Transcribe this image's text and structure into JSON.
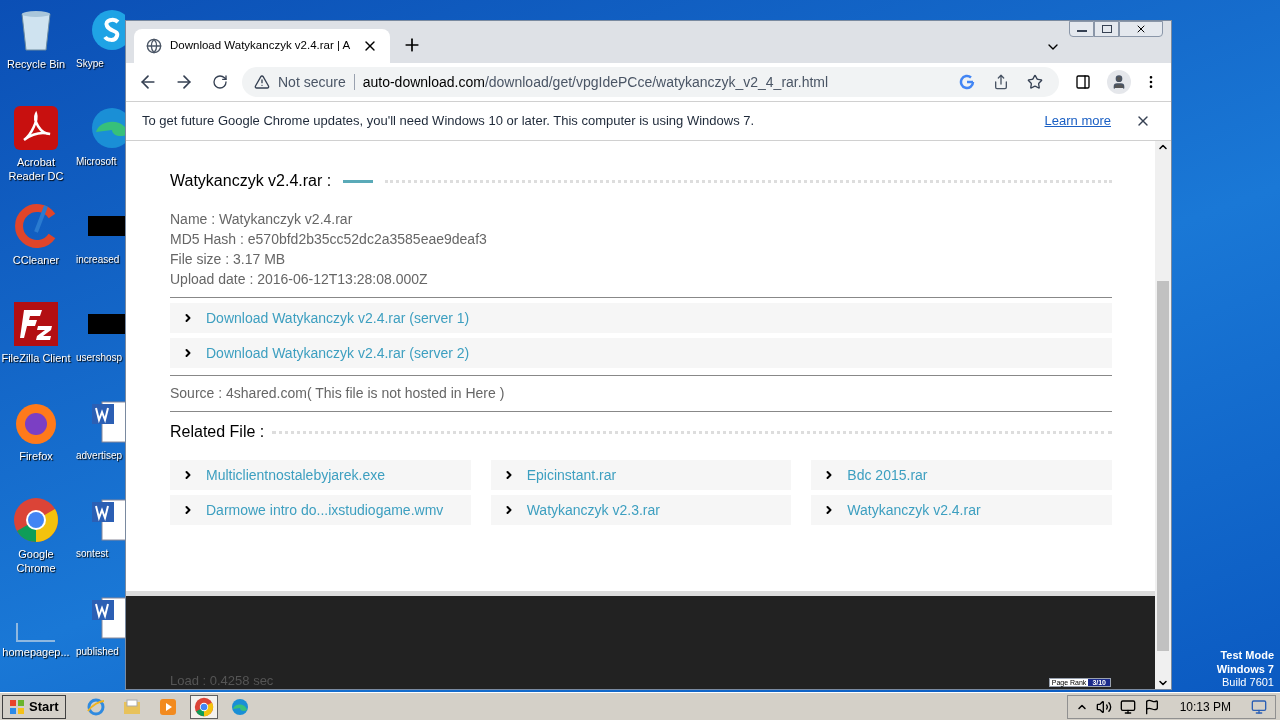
{
  "desktop": {
    "icons": [
      {
        "label": "Recycle Bin",
        "kind": "recycle"
      },
      {
        "label": "Skype",
        "kind": "skype"
      },
      {
        "label": "Acrobat Reader DC",
        "kind": "pdf"
      },
      {
        "label": "Microsoft",
        "kind": "edge"
      },
      {
        "label": "CCleaner",
        "kind": "ccleaner"
      },
      {
        "label": "increased",
        "kind": "black"
      },
      {
        "label": "FileZilla Client",
        "kind": "filezilla"
      },
      {
        "label": "usershosp",
        "kind": "black"
      },
      {
        "label": "Firefox",
        "kind": "firefox"
      },
      {
        "label": "advertisep",
        "kind": "word"
      },
      {
        "label": "Google Chrome",
        "kind": "chrome"
      },
      {
        "label": "sontest",
        "kind": "word"
      },
      {
        "label": "homepagep...",
        "kind": "blank"
      },
      {
        "label": "published",
        "kind": "word"
      }
    ],
    "watermark": [
      "Test Mode",
      "Windows 7",
      "Build 7601"
    ]
  },
  "browser": {
    "tab": {
      "title": "Download Watykanczyk v2.4.rar | A",
      "selected": true
    },
    "address": {
      "security": "Not secure",
      "host": "auto-download.com",
      "path": "/download/get/vpgIdePCce/watykanczyk_v2_4_rar.html"
    },
    "infobar": {
      "message": "To get future Google Chrome updates, you'll need Windows 10 or later. This computer is using Windows 7.",
      "link": "Learn more"
    }
  },
  "page": {
    "heading": "Watykanczyk v2.4.rar :",
    "details": [
      "Name : Watykanczyk v2.4.rar",
      "MD5 Hash : e570bfd2b35cc52dc2a3585eae9deaf3",
      "File size : 3.17 MB",
      "Upload date : 2016-06-12T13:28:08.000Z"
    ],
    "downloads": [
      "Download Watykanczyk v2.4.rar (server 1)",
      "Download Watykanczyk v2.4.rar (server 2)"
    ],
    "source": "Source : 4shared.com( This file is not hosted in Here )",
    "related_heading": "Related File :",
    "related": [
      "Multiclientnostalebyjarek.exe",
      "Epicinstant.rar",
      "Bdc 2015.rar",
      "Darmowe intro do...ixstudiogame.wmv",
      "Watykanczyk v2.3.rar",
      "Watykanczyk v2.4.rar"
    ],
    "footer": {
      "load": "Load : 0.4258 sec",
      "rank_label": "Page Rank",
      "rank_value": "3/10"
    }
  },
  "taskbar": {
    "start": "Start",
    "apps": [
      {
        "kind": "ie",
        "selected": false
      },
      {
        "kind": "explorer",
        "selected": false
      },
      {
        "kind": "media",
        "selected": false
      },
      {
        "kind": "chrome",
        "selected": true
      },
      {
        "kind": "edge",
        "selected": false
      }
    ],
    "time": "10:13 PM"
  }
}
